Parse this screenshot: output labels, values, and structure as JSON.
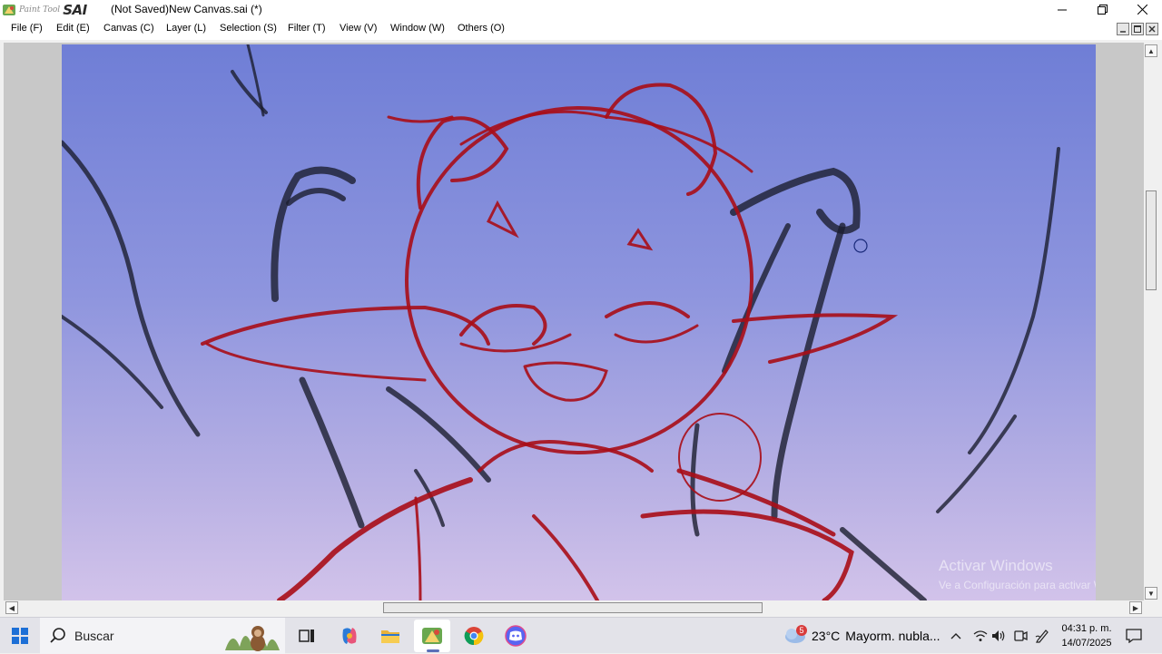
{
  "window": {
    "app_logo_small": "Paint Tool",
    "app_logo_big": "SAI",
    "title": "(Not Saved)New Canvas.sai (*)"
  },
  "menu": [
    {
      "label": "File (F)"
    },
    {
      "label": "Edit (E)"
    },
    {
      "label": "Canvas (C)"
    },
    {
      "label": "Layer (L)"
    },
    {
      "label": "Selection (S)"
    },
    {
      "label": "Filter (T)"
    },
    {
      "label": "View (V)"
    },
    {
      "label": "Window (W)"
    },
    {
      "label": "Others (O)"
    }
  ],
  "canvas": {
    "background_top": "#6f7ed6",
    "background_bottom": "#d2c3ea",
    "sketch_red": "#a80d17",
    "sketch_dark": "#1b1e30"
  },
  "watermark": {
    "title": "Activar Windows",
    "subtitle": "Ve a Configuración para activar Windows."
  },
  "taskbar": {
    "search_placeholder": "Buscar",
    "weather_temp": "23°C",
    "weather_text": "Mayorm. nubla...",
    "weather_badge": "5",
    "time": "04:31 p. m.",
    "date": "14/07/2025",
    "icons": [
      "start-icon",
      "task-view-icon",
      "copilot-icon",
      "file-explorer-icon",
      "paint-tool-sai-icon",
      "chrome-icon",
      "discord-icon"
    ]
  }
}
